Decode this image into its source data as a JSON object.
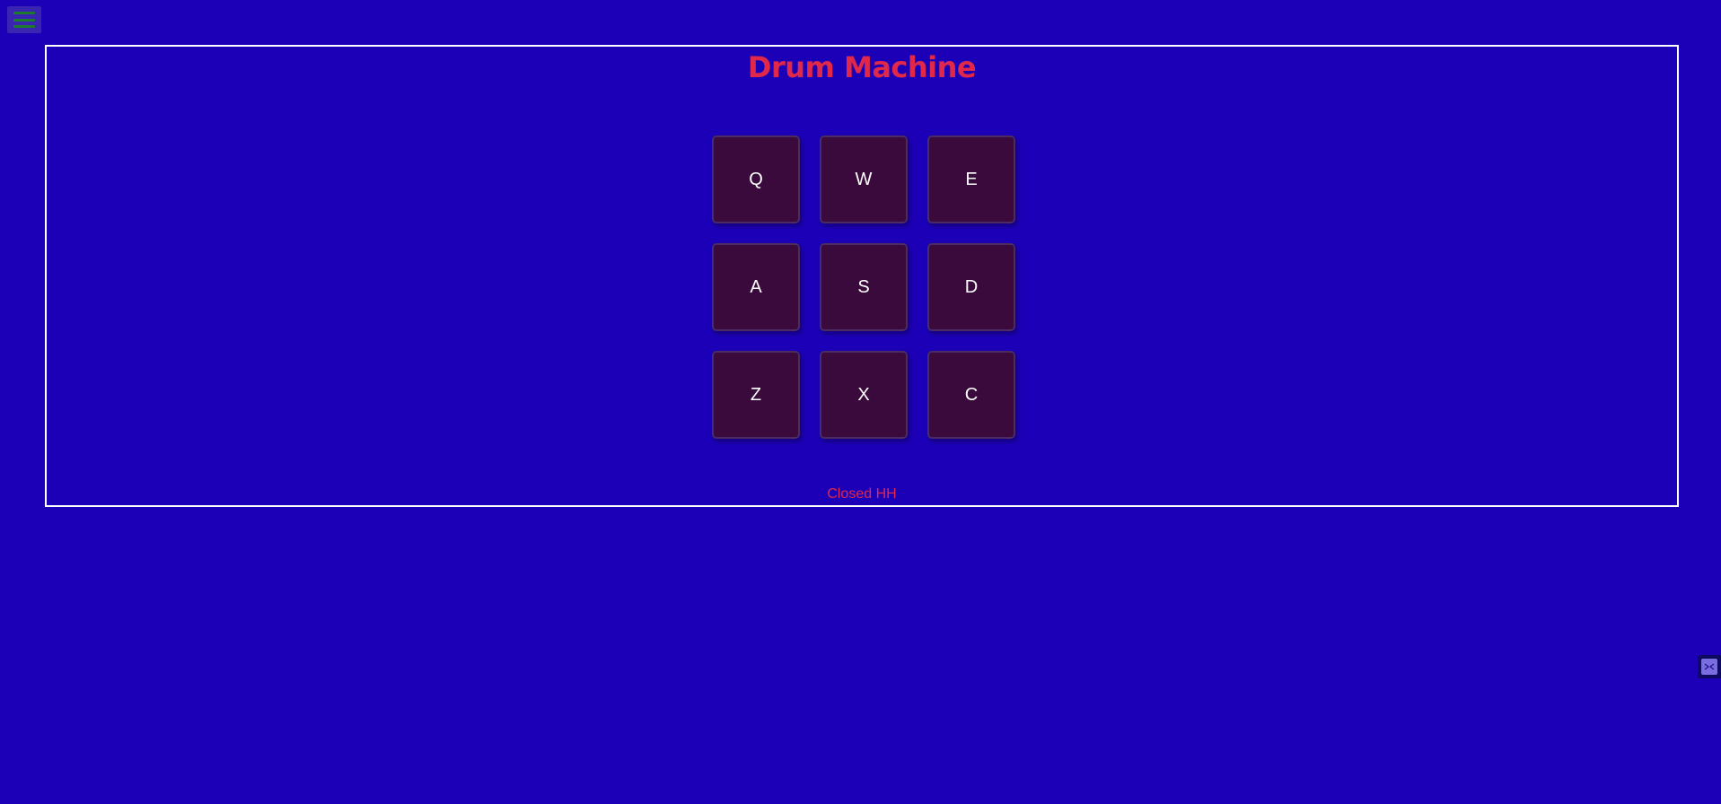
{
  "app": {
    "title": "Drum Machine"
  },
  "pads": [
    {
      "key": "Q"
    },
    {
      "key": "W"
    },
    {
      "key": "E"
    },
    {
      "key": "A"
    },
    {
      "key": "S"
    },
    {
      "key": "D"
    },
    {
      "key": "Z"
    },
    {
      "key": "X"
    },
    {
      "key": "C"
    }
  ],
  "display": {
    "text": "Closed HH"
  },
  "icons": {
    "menu": "menu-icon",
    "side_widget": "expand-icon"
  },
  "colors": {
    "background": "#1c00b8",
    "title": "#e0284a",
    "pad": "#3a0a3c",
    "pad_text": "#ffffff",
    "display_text": "#e0284a",
    "menu_bars": "#1a7a2e"
  }
}
